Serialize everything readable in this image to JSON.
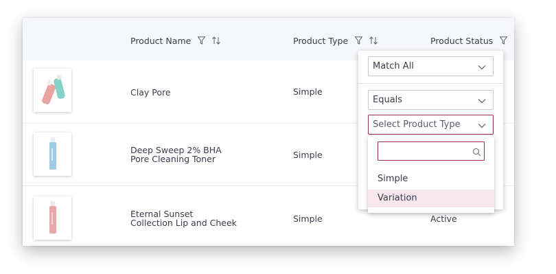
{
  "table": {
    "columns": [
      {
        "label": "Product Name"
      },
      {
        "label": "Product Type"
      },
      {
        "label": "Product Status"
      }
    ],
    "rows": [
      {
        "name_line1": "Clay Pore",
        "name_line2": "",
        "type": "Simple",
        "status": ""
      },
      {
        "name_line1": "Deep Sweep 2% BHA",
        "name_line2": "Pore Cleaning Toner",
        "type": "Simple",
        "status": ""
      },
      {
        "name_line1": "Eternal Sunset",
        "name_line2": "Collection Lip and Cheek",
        "type": "Simple",
        "status": "Active"
      }
    ]
  },
  "filter": {
    "match_mode": "Match All",
    "operator": "Equals",
    "value_placeholder": "Select Product Type",
    "search_value": "",
    "options": [
      "Simple",
      "Variation"
    ],
    "highlighted_option": "Variation"
  },
  "colors": {
    "header_bg": "#f6f7fb",
    "accent": "#9b2c45",
    "highlight": "#f8e8ee"
  },
  "icons": [
    "filter-icon",
    "sort-icon",
    "chevron-down-icon",
    "search-icon"
  ]
}
